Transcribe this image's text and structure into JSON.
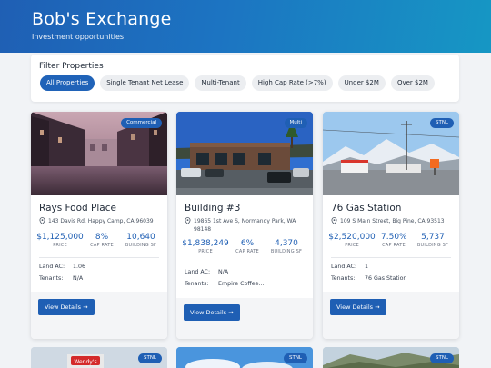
{
  "header": {
    "brand": "Bob's Exchange",
    "subtitle": "Investment opportunities"
  },
  "filters": {
    "title": "Filter Properties",
    "chips": [
      "All Properties",
      "Single Tenant Net Lease",
      "Multi-Tenant",
      "High Cap Rate (>7%)",
      "Under $2M",
      "Over $2M"
    ],
    "active_chip": "All Properties"
  },
  "cards": [
    {
      "badge": "Commercial",
      "title": "Rays Food Place",
      "address": "143 Davis Rd, Happy Camp, CA 96039",
      "price": "$1,125,000",
      "price_label": "PRICE",
      "cap": "8%",
      "cap_label": "CAP RATE",
      "sf": "10,640",
      "sf_label": "BUILDING SF",
      "land_label": "Land AC:",
      "land": "1.06",
      "tenants_label": "Tenants:",
      "tenants": "N/A",
      "button": "View Details →"
    },
    {
      "badge": "Multi",
      "title": "Building #3",
      "address": "19865 1st Ave S, Normandy Park, WA 98148",
      "price": "$1,838,249",
      "price_label": "PRICE",
      "cap": "6%",
      "cap_label": "CAP RATE",
      "sf": "4,370",
      "sf_label": "BUILDING SF",
      "land_label": "Land AC:",
      "land": "N/A",
      "tenants_label": "Tenants:",
      "tenants": "Empire Coffee...",
      "button": "View Details →"
    },
    {
      "badge": "STNL",
      "title": "76 Gas Station",
      "address": "109 S Main Street, Big Pine, CA 93513",
      "price": "$2,520,000",
      "price_label": "PRICE",
      "cap": "7.50%",
      "cap_label": "CAP RATE",
      "sf": "5,737",
      "sf_label": "BUILDING SF",
      "land_label": "Land AC:",
      "land": "1",
      "tenants_label": "Tenants:",
      "tenants": "76 Gas Station",
      "button": "View Details →"
    }
  ],
  "more_cards": [
    {
      "badge": "STNL",
      "sign": "Wendy's"
    },
    {
      "badge": "STNL"
    },
    {
      "badge": "STNL"
    }
  ],
  "colors": {
    "primary": "#1f5fb4",
    "header_end": "#1697c4",
    "background": "#f1f3f6"
  },
  "icons": {
    "location": "map-pin-icon",
    "arrow": "arrow-right-icon"
  }
}
